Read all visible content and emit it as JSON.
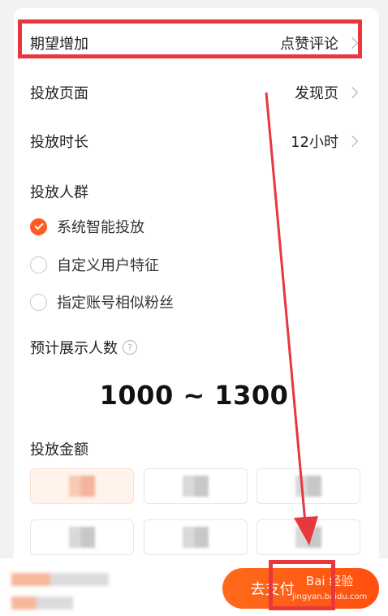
{
  "form": {
    "expected_increase": {
      "label": "期望增加",
      "value": "点赞评论"
    },
    "placement_page": {
      "label": "投放页面",
      "value": "发现页"
    },
    "duration": {
      "label": "投放时长",
      "value": "12小时"
    },
    "audience": {
      "title": "投放人群",
      "options": [
        {
          "label": "系统智能投放",
          "checked": true
        },
        {
          "label": "自定义用户特征",
          "checked": false
        },
        {
          "label": "指定账号相似粉丝",
          "checked": false
        }
      ]
    },
    "estimate": {
      "title": "预计展示人数",
      "help_icon": "?",
      "value": "1000 ~ 1300"
    },
    "amount": {
      "title": "投放金额"
    }
  },
  "bottom": {
    "pay_button_label": "去支付"
  },
  "watermark": {
    "text": "Bai 经验",
    "sub": "jingyan.baidu.com"
  },
  "colors": {
    "accent": "#ff5a1f",
    "highlight": "#e8373d"
  }
}
